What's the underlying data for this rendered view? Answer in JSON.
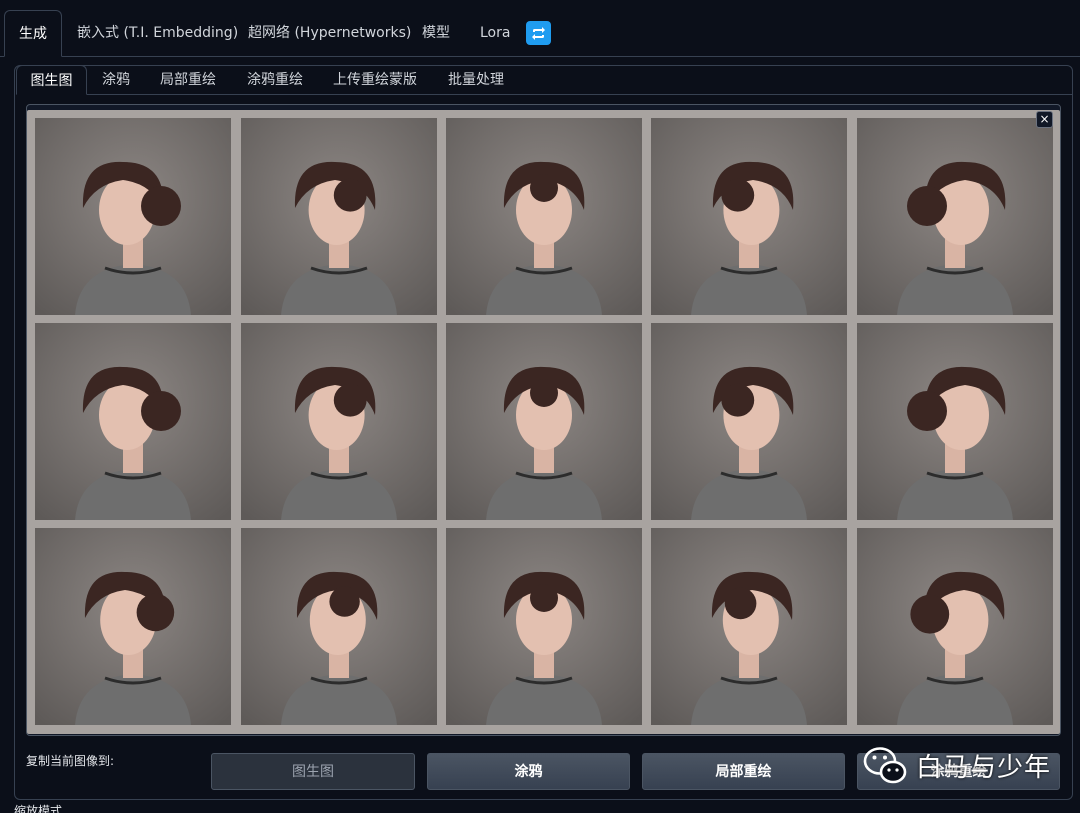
{
  "top_tabs": [
    {
      "label": "生成",
      "active": true
    },
    {
      "label": "嵌入式 (T.I. Embedding)"
    },
    {
      "label": "超网络 (Hypernetworks)"
    },
    {
      "label": "模型"
    },
    {
      "label": "Lora"
    }
  ],
  "sub_tabs": [
    {
      "label": "图生图",
      "active": true
    },
    {
      "label": "涂鸦"
    },
    {
      "label": "局部重绘"
    },
    {
      "label": "涂鸦重绘"
    },
    {
      "label": "上传重绘蒙版"
    },
    {
      "label": "批量处理"
    }
  ],
  "gallery": {
    "close_symbol": "×",
    "image_count": 15
  },
  "copy_section": {
    "label": "复制当前图像到:",
    "buttons": [
      {
        "label": "图生图",
        "disabled": true
      },
      {
        "label": "涂鸦"
      },
      {
        "label": "局部重绘"
      },
      {
        "label": "涂鸦重绘"
      }
    ]
  },
  "scale_label": "缩放模式",
  "watermark": {
    "text": "白马与少年"
  },
  "colors": {
    "bg": "#0b0f19",
    "border": "#374151",
    "accent": "#1f9cf0"
  },
  "icons": {
    "refresh": "refresh-icon",
    "watermark": "wechat-icon"
  }
}
